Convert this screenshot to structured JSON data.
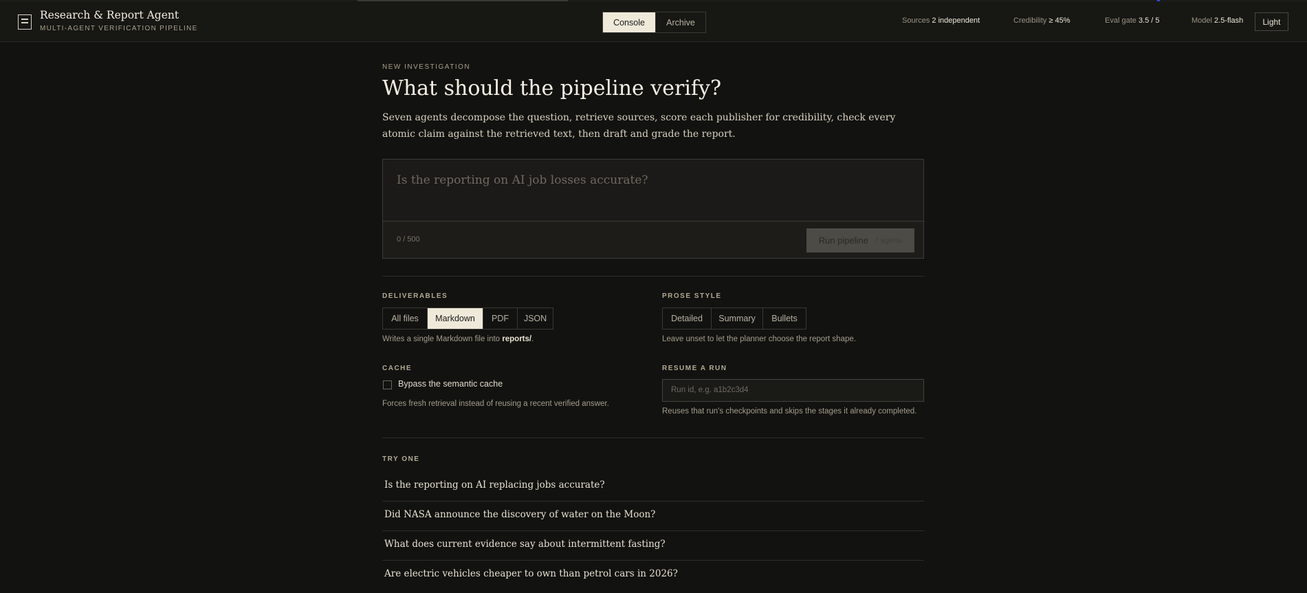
{
  "app": {
    "title": "Research & Report Agent",
    "subtitle": "MULTI-AGENT VERIFICATION PIPELINE"
  },
  "nav": {
    "tabs": [
      {
        "label": "Console",
        "active": true
      },
      {
        "label": "Archive",
        "active": false
      }
    ]
  },
  "stats": [
    {
      "label": "Sources",
      "value": "2 independent"
    },
    {
      "label": "Credibility",
      "value": "≥ 45%"
    },
    {
      "label": "Eval gate",
      "value": "3.5 / 5"
    },
    {
      "label": "Model",
      "value": "2.5-flash"
    }
  ],
  "theme_toggle": "Light",
  "intro": {
    "eyebrow": "NEW INVESTIGATION",
    "heading": "What should the pipeline verify?",
    "description": "Seven agents decompose the question, retrieve sources, score each publisher for credibility, check every atomic claim against the retrieved text, then draft and grade the report."
  },
  "composer": {
    "placeholder": "Is the reporting on AI job losses accurate?",
    "value": "",
    "char_count": "0 / 500",
    "run_label": "Run pipeline",
    "run_hint": "7 agents"
  },
  "deliverables": {
    "label": "DELIVERABLES",
    "options": [
      {
        "label": "All files",
        "active": false
      },
      {
        "label": "Markdown",
        "active": true
      },
      {
        "label": "PDF",
        "active": false
      },
      {
        "label": "JSON",
        "active": false
      }
    ],
    "help_prefix": "Writes a single Markdown file into ",
    "help_path": "reports/",
    "help_suffix": "."
  },
  "prose_style": {
    "label": "PROSE STYLE",
    "options": [
      {
        "label": "Detailed",
        "active": false
      },
      {
        "label": "Summary",
        "active": false
      },
      {
        "label": "Bullets",
        "active": false
      }
    ],
    "help": "Leave unset to let the planner choose the report shape."
  },
  "cache": {
    "label": "CACHE",
    "checkbox_label": "Bypass the semantic cache",
    "checked": false,
    "help": "Forces fresh retrieval instead of reusing a recent verified answer."
  },
  "resume": {
    "label": "RESUME A RUN",
    "placeholder": "Run id, e.g. a1b2c3d4",
    "help": "Reuses that run's checkpoints and skips the stages it already completed."
  },
  "examples": {
    "label": "TRY ONE",
    "items": [
      "Is the reporting on AI replacing jobs accurate?",
      "Did NASA announce the discovery of water on the Moon?",
      "What does current evidence say about intermittent fasting?",
      "Are electric vehicles cheaper to own than petrol cars in 2026?"
    ]
  }
}
